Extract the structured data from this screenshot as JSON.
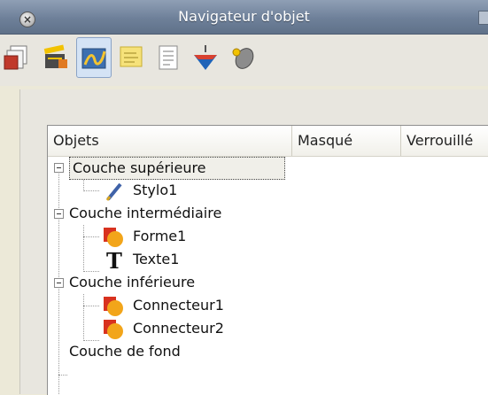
{
  "window": {
    "title": "Navigateur d'objet"
  },
  "toolbar": {
    "tools": [
      {
        "icon": "layers-icon"
      },
      {
        "icon": "clapperboard-icon"
      },
      {
        "icon": "drawing-icon",
        "active": true
      },
      {
        "icon": "sticky-note-icon"
      },
      {
        "icon": "document-icon"
      },
      {
        "icon": "spinning-top-icon"
      },
      {
        "icon": "mouse-icon"
      }
    ]
  },
  "table": {
    "columns": [
      "Objets",
      "Masqué",
      "Verrouillé"
    ],
    "rows": [
      {
        "label": "Couche supérieure",
        "type": "layer"
      },
      {
        "label": "Stylo1",
        "type": "pen"
      },
      {
        "label": "Couche intermédiaire",
        "type": "layer"
      },
      {
        "label": "Forme1",
        "type": "shape"
      },
      {
        "label": "Texte1",
        "type": "text"
      },
      {
        "label": "Couche inférieure",
        "type": "layer"
      },
      {
        "label": "Connecteur1",
        "type": "connector"
      },
      {
        "label": "Connecteur2",
        "type": "connector"
      },
      {
        "label": "Couche de fond",
        "type": "layer"
      }
    ]
  },
  "colors": {
    "titlebar": "#6e8099",
    "selection_border": "#444444",
    "shape_icon": "#e8751a"
  }
}
